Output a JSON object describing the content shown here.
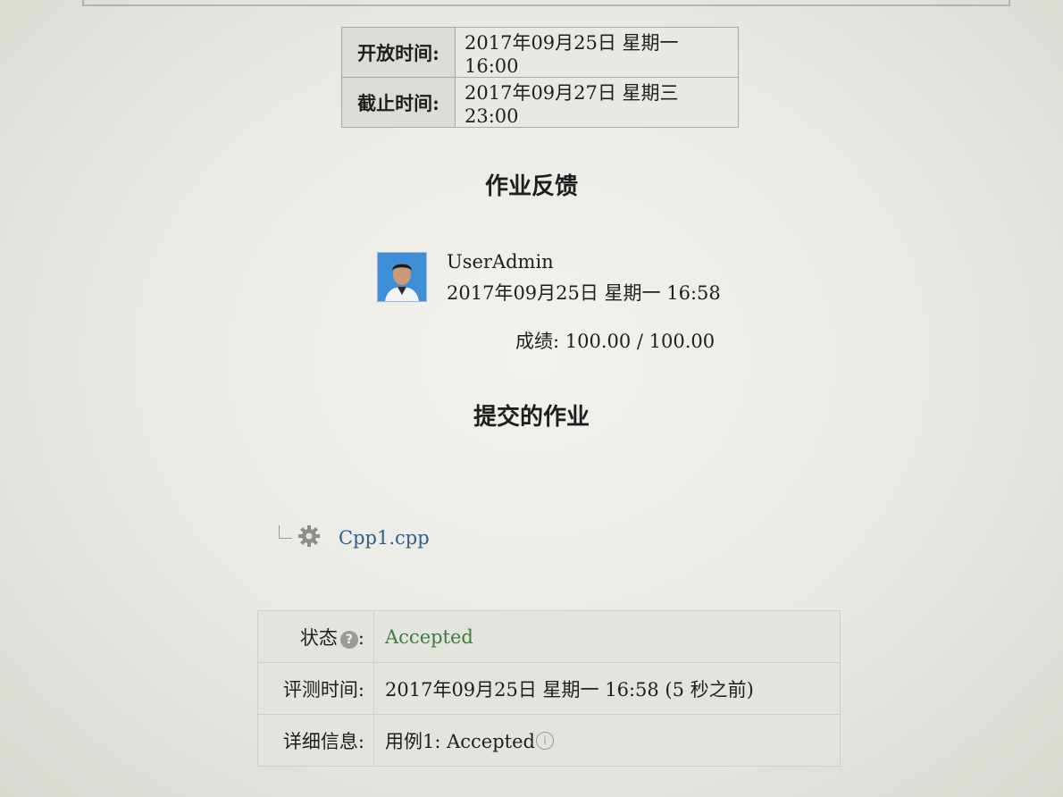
{
  "dates": [
    {
      "label": "开放时间:",
      "value": "2017年09月25日 星期一 16:00"
    },
    {
      "label": "截止时间:",
      "value": "2017年09月27日 星期三 23:00"
    }
  ],
  "feedback": {
    "title": "作业反馈",
    "user_name": "UserAdmin",
    "time": "2017年09月25日 星期一 16:58",
    "grade": "成绩: 100.00 / 100.00"
  },
  "submission": {
    "title": "提交的作业",
    "file_name": "Cpp1.cpp",
    "icons": {
      "file": "gear-icon",
      "status_help": "help-icon",
      "detail_info": "info-icon"
    }
  },
  "status": {
    "state_label": "状态",
    "state_value": "Accepted",
    "judge_time_label": "评测时间:",
    "judge_time_value": "2017年09月25日 星期一 16:58 (5 秒之前)",
    "detail_label": "详细信息:",
    "detail_value": "用例1: Accepted"
  },
  "colors": {
    "accepted": "#3b7d3b",
    "link": "#2c5f8e"
  }
}
